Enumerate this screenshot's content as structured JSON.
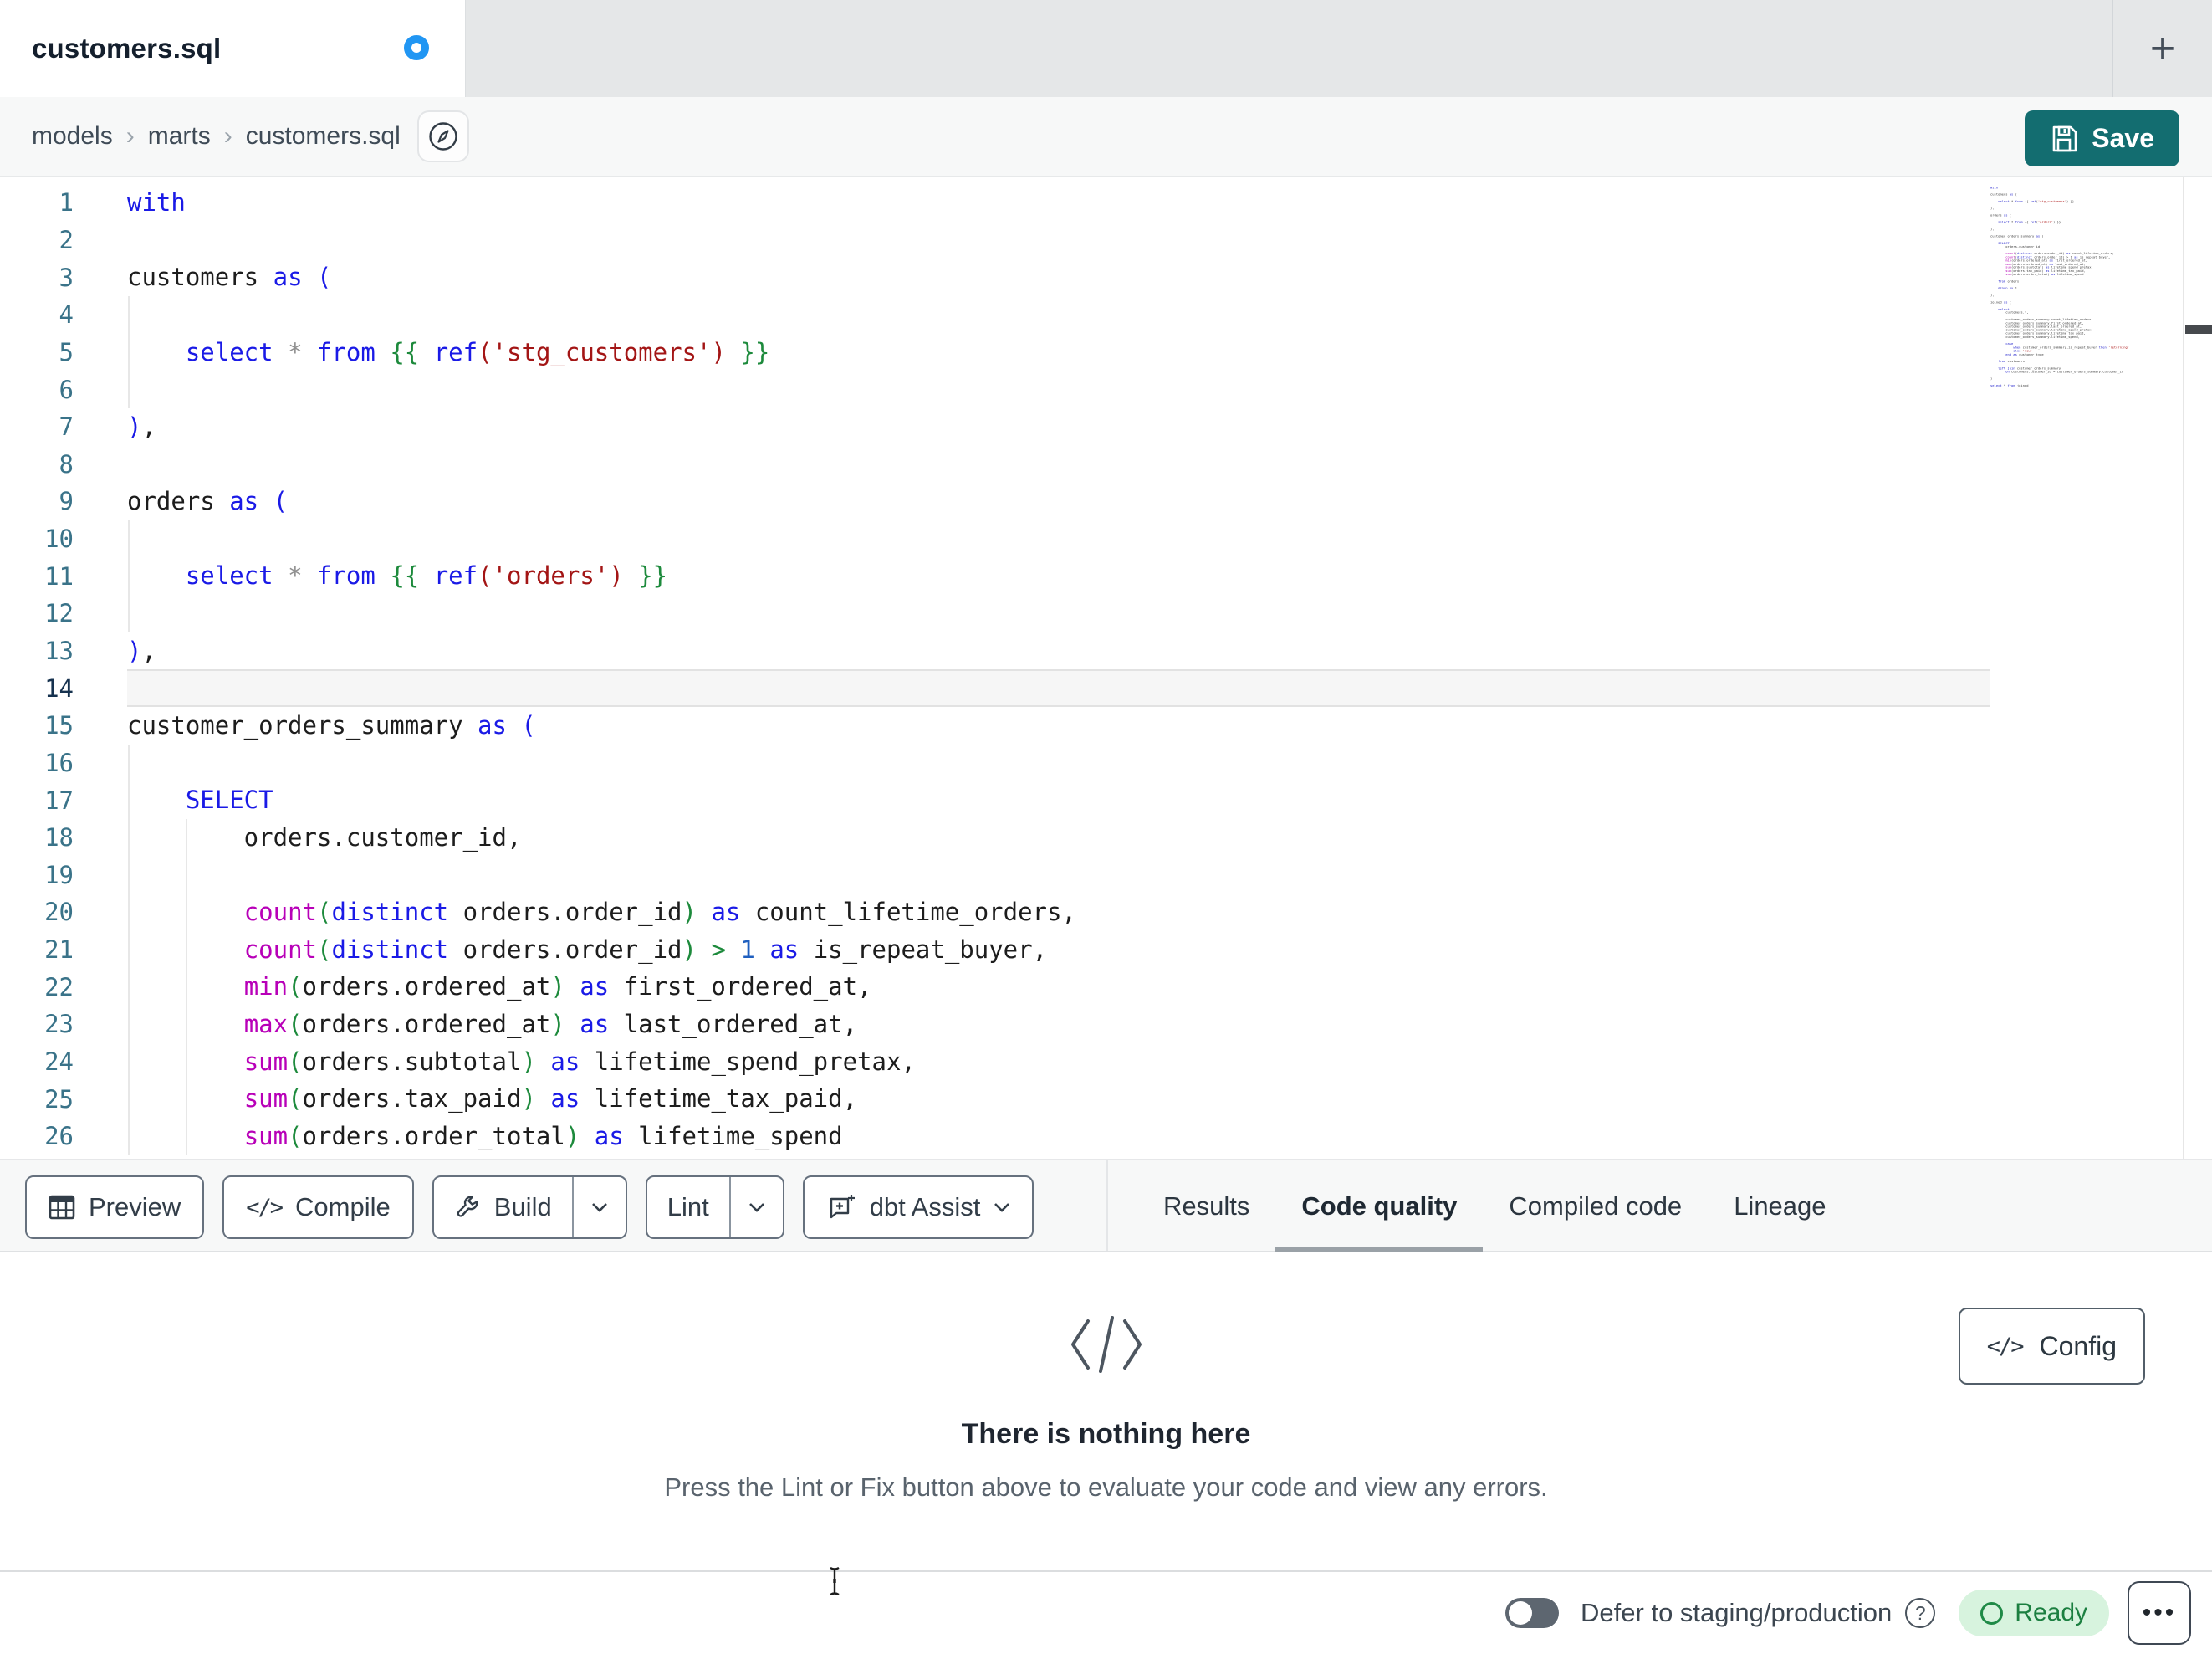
{
  "window": {
    "tab_title": "customers.sql",
    "new_tab_glyph": "+"
  },
  "breadcrumb": {
    "items": [
      "models",
      "marts",
      "customers.sql"
    ],
    "separator": "›"
  },
  "save": {
    "label": "Save"
  },
  "editor": {
    "active_line": 14,
    "lines": [
      {
        "n": 1,
        "tokens": [
          [
            "kw",
            "with"
          ]
        ]
      },
      {
        "n": 2,
        "tokens": []
      },
      {
        "n": 3,
        "tokens": [
          [
            "id",
            "customers "
          ],
          [
            "kw",
            "as ("
          ]
        ]
      },
      {
        "n": 4,
        "tokens": []
      },
      {
        "n": 5,
        "tokens": [
          [
            "id",
            "    "
          ],
          [
            "kw",
            "select"
          ],
          [
            "id",
            " "
          ],
          [
            "op",
            "*"
          ],
          [
            "id",
            " "
          ],
          [
            "kw",
            "from"
          ],
          [
            "id",
            " "
          ],
          [
            "g",
            "{{"
          ],
          [
            "id",
            " "
          ],
          [
            "kw",
            "ref"
          ],
          [
            "s",
            "('stg_customers')"
          ],
          [
            "id",
            " "
          ],
          [
            "g",
            "}}"
          ]
        ]
      },
      {
        "n": 6,
        "tokens": []
      },
      {
        "n": 7,
        "tokens": [
          [
            "kw",
            ")"
          ],
          [
            "id",
            ","
          ]
        ]
      },
      {
        "n": 8,
        "tokens": []
      },
      {
        "n": 9,
        "tokens": [
          [
            "id",
            "orders "
          ],
          [
            "kw",
            "as ("
          ]
        ]
      },
      {
        "n": 10,
        "tokens": []
      },
      {
        "n": 11,
        "tokens": [
          [
            "id",
            "    "
          ],
          [
            "kw",
            "select"
          ],
          [
            "id",
            " "
          ],
          [
            "op",
            "*"
          ],
          [
            "id",
            " "
          ],
          [
            "kw",
            "from"
          ],
          [
            "id",
            " "
          ],
          [
            "g",
            "{{"
          ],
          [
            "id",
            " "
          ],
          [
            "kw",
            "ref"
          ],
          [
            "s",
            "('orders')"
          ],
          [
            "id",
            " "
          ],
          [
            "g",
            "}}"
          ]
        ]
      },
      {
        "n": 12,
        "tokens": []
      },
      {
        "n": 13,
        "tokens": [
          [
            "kw",
            ")"
          ],
          [
            "id",
            ","
          ]
        ]
      },
      {
        "n": 14,
        "tokens": []
      },
      {
        "n": 15,
        "tokens": [
          [
            "id",
            "customer_orders_summary "
          ],
          [
            "kw",
            "as ("
          ]
        ]
      },
      {
        "n": 16,
        "tokens": []
      },
      {
        "n": 17,
        "tokens": [
          [
            "id",
            "    "
          ],
          [
            "kw",
            "SELECT"
          ]
        ]
      },
      {
        "n": 18,
        "tokens": [
          [
            "id",
            "        orders.customer_id,"
          ]
        ]
      },
      {
        "n": 19,
        "tokens": []
      },
      {
        "n": 20,
        "tokens": [
          [
            "id",
            "        "
          ],
          [
            "fn",
            "count"
          ],
          [
            "g",
            "("
          ],
          [
            "kw",
            "distinct"
          ],
          [
            "id",
            " orders.order_id"
          ],
          [
            "g",
            ")"
          ],
          [
            "id",
            " "
          ],
          [
            "kw",
            "as"
          ],
          [
            "id",
            " count_lifetime_orders,"
          ]
        ]
      },
      {
        "n": 21,
        "tokens": [
          [
            "id",
            "        "
          ],
          [
            "fn",
            "count"
          ],
          [
            "g",
            "("
          ],
          [
            "kw",
            "distinct"
          ],
          [
            "id",
            " orders.order_id"
          ],
          [
            "g",
            ")"
          ],
          [
            "id",
            " "
          ],
          [
            "g",
            ">"
          ],
          [
            "id",
            " "
          ],
          [
            "num",
            "1"
          ],
          [
            "id",
            " "
          ],
          [
            "kw",
            "as"
          ],
          [
            "id",
            " is_repeat_buyer,"
          ]
        ]
      },
      {
        "n": 22,
        "tokens": [
          [
            "id",
            "        "
          ],
          [
            "fn",
            "min"
          ],
          [
            "g",
            "("
          ],
          [
            "id",
            "orders.ordered_at"
          ],
          [
            "g",
            ")"
          ],
          [
            "id",
            " "
          ],
          [
            "kw",
            "as"
          ],
          [
            "id",
            " first_ordered_at,"
          ]
        ]
      },
      {
        "n": 23,
        "tokens": [
          [
            "id",
            "        "
          ],
          [
            "fn",
            "max"
          ],
          [
            "g",
            "("
          ],
          [
            "id",
            "orders.ordered_at"
          ],
          [
            "g",
            ")"
          ],
          [
            "id",
            " "
          ],
          [
            "kw",
            "as"
          ],
          [
            "id",
            " last_ordered_at,"
          ]
        ]
      },
      {
        "n": 24,
        "tokens": [
          [
            "id",
            "        "
          ],
          [
            "fn",
            "sum"
          ],
          [
            "g",
            "("
          ],
          [
            "id",
            "orders.subtotal"
          ],
          [
            "g",
            ")"
          ],
          [
            "id",
            " "
          ],
          [
            "kw",
            "as"
          ],
          [
            "id",
            " lifetime_spend_pretax,"
          ]
        ]
      },
      {
        "n": 25,
        "tokens": [
          [
            "id",
            "        "
          ],
          [
            "fn",
            "sum"
          ],
          [
            "g",
            "("
          ],
          [
            "id",
            "orders.tax_paid"
          ],
          [
            "g",
            ")"
          ],
          [
            "id",
            " "
          ],
          [
            "kw",
            "as"
          ],
          [
            "id",
            " lifetime_tax_paid,"
          ]
        ]
      },
      {
        "n": 26,
        "tokens": [
          [
            "id",
            "        "
          ],
          [
            "fn",
            "sum"
          ],
          [
            "g",
            "("
          ],
          [
            "id",
            "orders.order_total"
          ],
          [
            "g",
            ")"
          ],
          [
            "id",
            " "
          ],
          [
            "kw",
            "as"
          ],
          [
            "id",
            " lifetime_spend"
          ]
        ]
      }
    ],
    "guides": [
      {
        "col": 0,
        "from": 4,
        "to": 6
      },
      {
        "col": 0,
        "from": 10,
        "to": 12
      },
      {
        "col": 0,
        "from": 16,
        "to": 26
      },
      {
        "col": 4,
        "from": 18,
        "to": 26
      }
    ]
  },
  "minimap": {
    "lines": [
      "with",
      "",
      "customers as (",
      "",
      "    select * from {{ ref('stg_customers') }}",
      "",
      "),",
      "",
      "orders as (",
      "",
      "    select * from {{ ref('orders') }}",
      "",
      "),",
      "",
      "customer_orders_summary as (",
      "",
      "    SELECT",
      "        orders.customer_id,",
      "",
      "        count(distinct orders.order_id) as count_lifetime_orders,",
      "        count(distinct orders.order_id) > 1 as is_repeat_buyer,",
      "        min(orders.ordered_at) as first_ordered_at,",
      "        max(orders.ordered_at) as last_ordered_at,",
      "        sum(orders.subtotal) as lifetime_spend_pretax,",
      "        sum(orders.tax_paid) as lifetime_tax_paid,",
      "        sum(orders.order_total) as lifetime_spend",
      "",
      "    from orders",
      "",
      "    group by 1",
      "",
      "),",
      "",
      "joined as (",
      "",
      "    select",
      "        customers.*,",
      "",
      "        customer_orders_summary.count_lifetime_orders,",
      "        customer_orders_summary.first_ordered_at,",
      "        customer_orders_summary.last_ordered_at,",
      "        customer_orders_summary.lifetime_spend_pretax,",
      "        customer_orders_summary.lifetime_tax_paid,",
      "        customer_orders_summary.lifetime_spend,",
      "",
      "        case",
      "            when customer_orders_summary.is_repeat_buyer then 'returning'",
      "            else 'new'",
      "        end as customer_type",
      "",
      "    from customers",
      "",
      "    left join customer_orders_summary",
      "        on customers.customer_id = customer_orders_summary.customer_id",
      "",
      ")",
      "",
      "select * from joined"
    ]
  },
  "toolbar": {
    "preview_label": "Preview",
    "compile_label": "Compile",
    "build_label": "Build",
    "lint_label": "Lint",
    "assist_label": "dbt Assist",
    "code_glyph": "</>"
  },
  "panel_tabs": {
    "items": [
      "Results",
      "Code quality",
      "Compiled code",
      "Lineage"
    ],
    "active": "Code quality"
  },
  "empty_state": {
    "title": "There is nothing here",
    "subtitle": "Press the Lint or Fix button above to evaluate your code and view any errors."
  },
  "config": {
    "label": "Config",
    "code_glyph": "</>"
  },
  "statusbar": {
    "defer_label": "Defer to staging/production",
    "help_glyph": "?",
    "ready_label": "Ready",
    "ellipsis_glyph": "•••"
  },
  "colors": {
    "accent_teal": "#136d70",
    "unsaved_dot_blue": "#2196f3",
    "ready_bg": "#d7f3de",
    "ready_text": "#1b7f40",
    "keyword_blue": "#1a1ae6",
    "function_magenta": "#b800b8",
    "string_maroon": "#a31515",
    "jinja_green": "#1d8a3c",
    "line_number_teal": "#3a7389",
    "active_tab_underline": "#9aa1a7"
  }
}
